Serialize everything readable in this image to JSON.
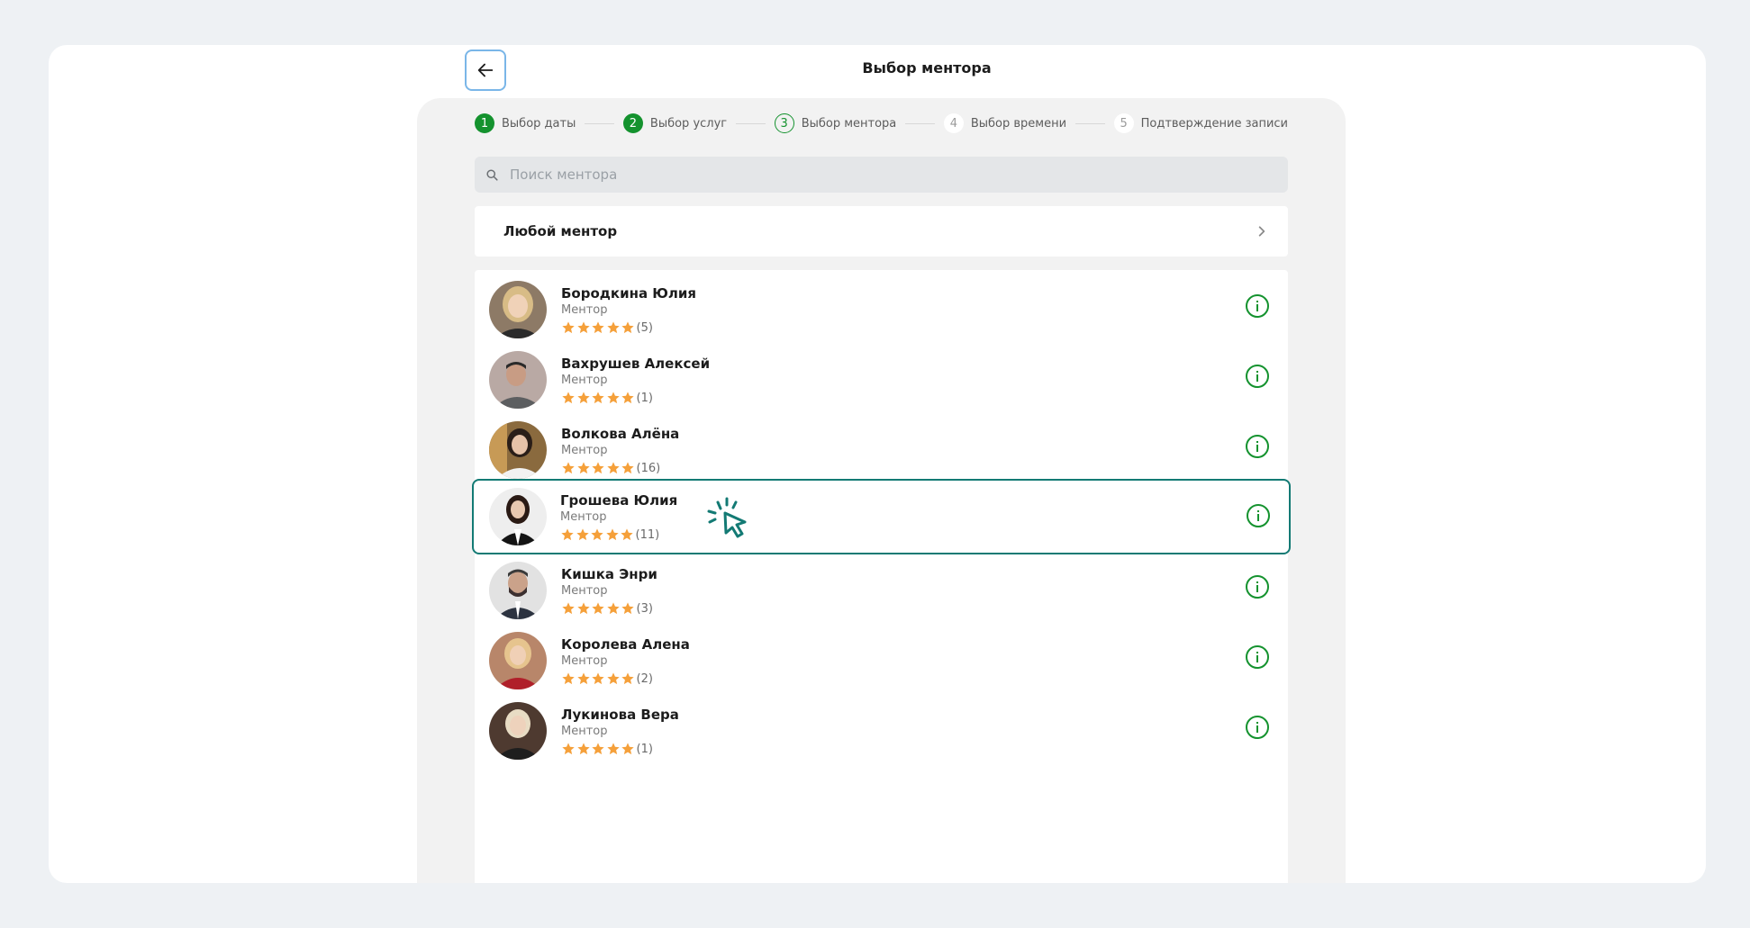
{
  "header": {
    "title": "Выбор ментора"
  },
  "stepper": [
    {
      "num": "1",
      "label": "Выбор даты",
      "state": "done"
    },
    {
      "num": "2",
      "label": "Выбор услуг",
      "state": "done"
    },
    {
      "num": "3",
      "label": "Выбор ментора",
      "state": "active"
    },
    {
      "num": "4",
      "label": "Выбор времени",
      "state": "todo"
    },
    {
      "num": "5",
      "label": "Подтверждение записи",
      "state": "todo"
    }
  ],
  "search": {
    "placeholder": "Поиск ментора",
    "value": ""
  },
  "any_mentor": {
    "label": "Любой ментор"
  },
  "mentors": [
    {
      "name": "Бородкина Юлия",
      "role": "Ментор",
      "rating_count": "(5)",
      "stars": 5,
      "selected": false
    },
    {
      "name": "Вахрушев Алексей",
      "role": "Ментор",
      "rating_count": "(1)",
      "stars": 5,
      "selected": false
    },
    {
      "name": "Волкова Алёна",
      "role": "Ментор",
      "rating_count": "(16)",
      "stars": 5,
      "selected": false
    },
    {
      "name": "Грошева Юлия",
      "role": "Ментор",
      "rating_count": "(11)",
      "stars": 5,
      "selected": true
    },
    {
      "name": "Кишка Энри",
      "role": "Ментор",
      "rating_count": "(3)",
      "stars": 5,
      "selected": false
    },
    {
      "name": "Королева Алена",
      "role": "Ментор",
      "rating_count": "(2)",
      "stars": 5,
      "selected": false
    },
    {
      "name": "Лукинова Вера",
      "role": "Ментор",
      "rating_count": "(1)",
      "stars": 5,
      "selected": false
    }
  ],
  "colors": {
    "accent_green": "#14922e",
    "selected_border": "#137a74",
    "star": "#f5a03a",
    "back_border": "#7ab6e8"
  },
  "icons": {
    "back": "arrow-left-icon",
    "search": "search-icon",
    "chevron": "chevron-right-icon",
    "info": "info-icon",
    "star": "star-icon",
    "cursor": "click-cursor-icon"
  }
}
